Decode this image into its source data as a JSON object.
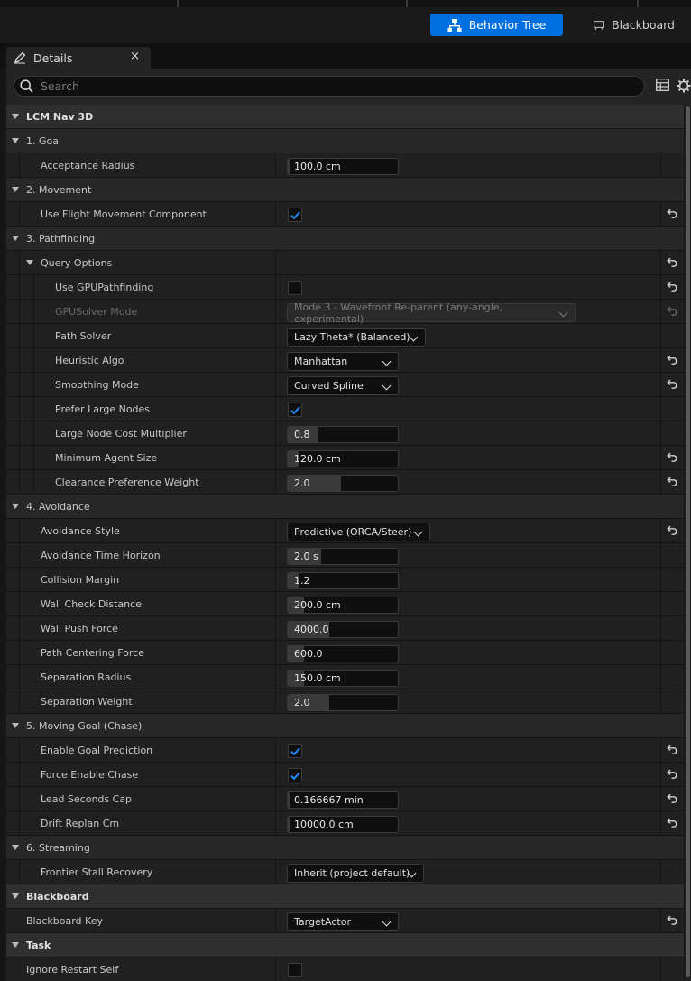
{
  "toolbar": {
    "behavior_tree_label": "Behavior Tree",
    "blackboard_label": "Blackboard",
    "accent_color": "#0070e0"
  },
  "tab": {
    "title": "Details",
    "close_glyph": "×"
  },
  "search": {
    "placeholder": "Search"
  },
  "rows": [
    {
      "kind": "section",
      "label": "LCM Nav 3D"
    },
    {
      "kind": "category",
      "label": "1. Goal"
    },
    {
      "kind": "prop",
      "depth": 1,
      "label": "Acceptance Radius",
      "type": "number",
      "value": "100.0 cm",
      "fill": 0.02,
      "reset": false
    },
    {
      "kind": "category",
      "label": "2. Movement"
    },
    {
      "kind": "prop",
      "depth": 1,
      "label": "Use Flight Movement Component",
      "type": "check",
      "checked": true,
      "reset": true
    },
    {
      "kind": "category",
      "label": "3. Pathfinding"
    },
    {
      "kind": "subcat",
      "depth": 1,
      "label": "Query Options",
      "reset": true
    },
    {
      "kind": "prop",
      "depth": 2,
      "label": "Use GPUPathfinding",
      "type": "check",
      "checked": false,
      "reset": true
    },
    {
      "kind": "prop",
      "depth": 2,
      "label": "GPUSolver Mode",
      "type": "combo",
      "value": "Mode 3 - Wavefront Re-parent (any-angle, experimental)",
      "disabled": true,
      "reset": true
    },
    {
      "kind": "prop",
      "depth": 2,
      "label": "Path Solver",
      "type": "combo",
      "value": "Lazy Theta* (Balanced)",
      "reset": false
    },
    {
      "kind": "prop",
      "depth": 2,
      "label": "Heuristic Algo",
      "type": "combo",
      "value": "Manhattan",
      "reset": true
    },
    {
      "kind": "prop",
      "depth": 2,
      "label": "Smoothing Mode",
      "type": "combo",
      "value": "Curved Spline",
      "reset": true
    },
    {
      "kind": "prop",
      "depth": 2,
      "label": "Prefer Large Nodes",
      "type": "check",
      "checked": true,
      "reset": false
    },
    {
      "kind": "prop",
      "depth": 2,
      "label": "Large Node Cost Multiplier",
      "type": "number",
      "value": "0.8",
      "fill": 0.28,
      "reset": false
    },
    {
      "kind": "prop",
      "depth": 2,
      "label": "Minimum Agent Size",
      "type": "number",
      "value": "120.0 cm",
      "fill": 0.1,
      "reset": true
    },
    {
      "kind": "prop",
      "depth": 2,
      "label": "Clearance Preference Weight",
      "type": "number",
      "value": "2.0",
      "fill": 0.48,
      "reset": true
    },
    {
      "kind": "category",
      "label": "4. Avoidance"
    },
    {
      "kind": "prop",
      "depth": 1,
      "label": "Avoidance Style",
      "type": "combo",
      "value": "Predictive (ORCA/Steer)",
      "reset": true
    },
    {
      "kind": "prop",
      "depth": 1,
      "label": "Avoidance Time Horizon",
      "type": "number",
      "value": "2.0 s",
      "fill": 0.3,
      "reset": false
    },
    {
      "kind": "prop",
      "depth": 1,
      "label": "Collision Margin",
      "type": "number",
      "value": "1.2",
      "fill": 0.1,
      "reset": false
    },
    {
      "kind": "prop",
      "depth": 1,
      "label": "Wall Check Distance",
      "type": "number",
      "value": "200.0 cm",
      "fill": 0.15,
      "reset": false
    },
    {
      "kind": "prop",
      "depth": 1,
      "label": "Wall Push Force",
      "type": "number",
      "value": "4000.0",
      "fill": 0.38,
      "reset": false
    },
    {
      "kind": "prop",
      "depth": 1,
      "label": "Path Centering Force",
      "type": "number",
      "value": "600.0",
      "fill": 0.15,
      "reset": false
    },
    {
      "kind": "prop",
      "depth": 1,
      "label": "Separation Radius",
      "type": "number",
      "value": "150.0 cm",
      "fill": 0.15,
      "reset": false
    },
    {
      "kind": "prop",
      "depth": 1,
      "label": "Separation Weight",
      "type": "number",
      "value": "2.0",
      "fill": 0.38,
      "reset": false
    },
    {
      "kind": "category",
      "label": "5. Moving Goal (Chase)"
    },
    {
      "kind": "prop",
      "depth": 1,
      "label": "Enable Goal Prediction",
      "type": "check",
      "checked": true,
      "reset": true
    },
    {
      "kind": "prop",
      "depth": 1,
      "label": "Force Enable Chase",
      "type": "check",
      "checked": true,
      "reset": true
    },
    {
      "kind": "prop",
      "depth": 1,
      "label": "Lead Seconds Cap",
      "type": "number",
      "value": "0.166667 min",
      "fill": 0.02,
      "reset": true
    },
    {
      "kind": "prop",
      "depth": 1,
      "label": "Drift Replan Cm",
      "type": "number",
      "value": "10000.0 cm",
      "fill": 0.02,
      "reset": true
    },
    {
      "kind": "category",
      "label": "6. Streaming"
    },
    {
      "kind": "prop",
      "depth": 1,
      "label": "Frontier Stall Recovery",
      "type": "combo",
      "value": "Inherit (project default)",
      "reset": false
    },
    {
      "kind": "section",
      "label": "Blackboard"
    },
    {
      "kind": "prop",
      "depth": 0,
      "label": "Blackboard Key",
      "type": "combo",
      "value": "TargetActor",
      "reset": true
    },
    {
      "kind": "section",
      "label": "Task"
    },
    {
      "kind": "prop",
      "depth": 0,
      "label": "Ignore Restart Self",
      "type": "check",
      "checked": false,
      "reset": false
    }
  ]
}
